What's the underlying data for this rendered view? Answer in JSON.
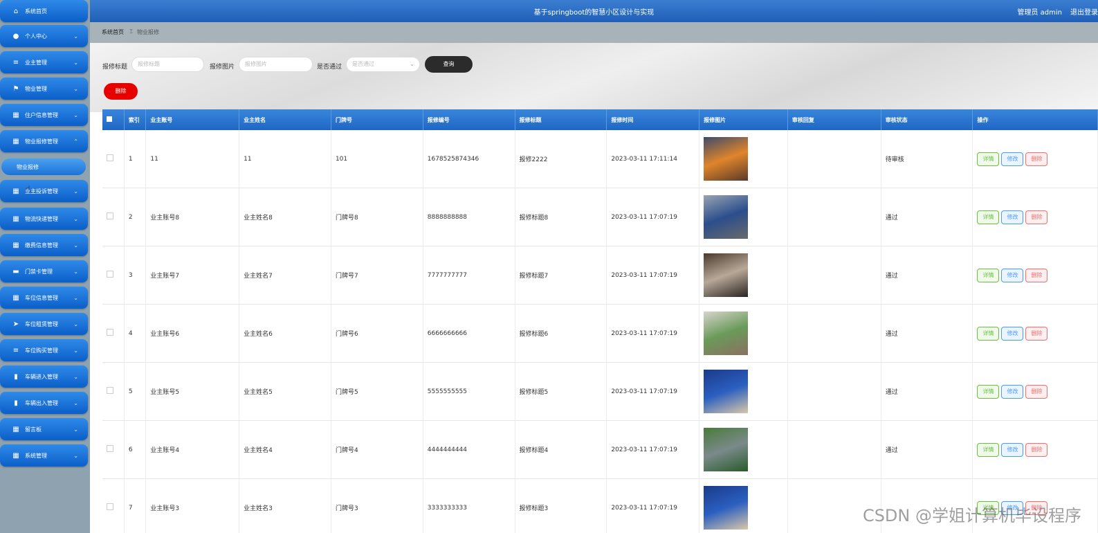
{
  "app_title": "基于springboot的智慧小区设计与实现",
  "user": {
    "label": "管理员 admin",
    "logout": "退出登录"
  },
  "breadcrumb": {
    "home": "系统首页",
    "sep": "Ξ",
    "current": "物业报修"
  },
  "sidebar": {
    "items": [
      {
        "label": "系统首页",
        "icon": "home-icon",
        "glyph": "⌂",
        "chev": ""
      },
      {
        "label": "个人中心",
        "icon": "user-icon",
        "glyph": "●",
        "chev": "⌄"
      },
      {
        "label": "业主管理",
        "icon": "list-icon",
        "glyph": "≡",
        "chev": "⌄"
      },
      {
        "label": "物业管理",
        "icon": "flag-icon",
        "glyph": "⚑",
        "chev": "⌄"
      },
      {
        "label": "住户信息管理",
        "icon": "grid-icon",
        "glyph": "▦",
        "chev": "⌄"
      },
      {
        "label": "物业报修管理",
        "icon": "grid-icon",
        "glyph": "▦",
        "chev": "⌃"
      },
      {
        "label": "业主投诉管理",
        "icon": "grid-icon",
        "glyph": "▦",
        "chev": "⌄"
      },
      {
        "label": "物流快递管理",
        "icon": "grid-icon",
        "glyph": "▦",
        "chev": "⌄"
      },
      {
        "label": "缴费信息管理",
        "icon": "grid-icon",
        "glyph": "▦",
        "chev": "⌄"
      },
      {
        "label": "门禁卡管理",
        "icon": "card-icon",
        "glyph": "▬",
        "chev": "⌄"
      },
      {
        "label": "车位信息管理",
        "icon": "grid-icon",
        "glyph": "▦",
        "chev": "⌄"
      },
      {
        "label": "车位租赁管理",
        "icon": "send-icon",
        "glyph": "➤",
        "chev": "⌄"
      },
      {
        "label": "车位购买管理",
        "icon": "list-icon",
        "glyph": "≡",
        "chev": "⌄"
      },
      {
        "label": "车辆进入管理",
        "icon": "bar-chart-icon",
        "glyph": "▮",
        "chev": "⌄"
      },
      {
        "label": "车辆出入管理",
        "icon": "bar-chart-icon",
        "glyph": "▮",
        "chev": "⌄"
      },
      {
        "label": "留言板",
        "icon": "grid-icon",
        "glyph": "▦",
        "chev": "⌄"
      },
      {
        "label": "系统管理",
        "icon": "grid-icon",
        "glyph": "▦",
        "chev": "⌄"
      }
    ],
    "sub_active": "物业报修"
  },
  "search": {
    "title_label": "报修标题",
    "title_placeholder": "报修标题",
    "image_label": "报修图片",
    "image_placeholder": "报修图片",
    "pass_label": "是否通过",
    "pass_placeholder": "是否通过",
    "query_button": "查询",
    "delete_button": "删除"
  },
  "table": {
    "headers": [
      "",
      "索引",
      "业主账号",
      "业主姓名",
      "门牌号",
      "报修编号",
      "报修标题",
      "报修时间",
      "报修图片",
      "审核回复",
      "审核状态",
      "操作"
    ],
    "ops": {
      "detail": "详情",
      "edit": "修改",
      "delete": "删除"
    },
    "rows": [
      {
        "idx": "1",
        "account": "11",
        "name": "11",
        "door": "101",
        "no": "1678525874346",
        "title": "报修2222",
        "time": "2023-03-11 17:11:14",
        "reply": "",
        "status": "待审核",
        "img": [
          "#3d4a6a",
          "#e0852a",
          "#5a3a2a"
        ]
      },
      {
        "idx": "2",
        "account": "业主账号8",
        "name": "业主姓名8",
        "door": "门牌号8",
        "no": "8888888888",
        "title": "报修标题8",
        "time": "2023-03-11 17:07:19",
        "reply": "",
        "status": "通过",
        "img": [
          "#9aa4b0",
          "#2b4e8c",
          "#6a6a6a"
        ]
      },
      {
        "idx": "3",
        "account": "业主账号7",
        "name": "业主姓名7",
        "door": "门牌号7",
        "no": "7777777777",
        "title": "报修标题7",
        "time": "2023-03-11 17:07:19",
        "reply": "",
        "status": "通过",
        "img": [
          "#4a3a2e",
          "#b8a898",
          "#2a2420"
        ]
      },
      {
        "idx": "4",
        "account": "业主账号6",
        "name": "业主姓名6",
        "door": "门牌号6",
        "no": "6666666666",
        "title": "报修标题6",
        "time": "2023-03-11 17:07:19",
        "reply": "",
        "status": "通过",
        "img": [
          "#d8d4cc",
          "#6a9a5a",
          "#8a7060"
        ]
      },
      {
        "idx": "5",
        "account": "业主账号5",
        "name": "业主姓名5",
        "door": "门牌号5",
        "no": "5555555555",
        "title": "报修标题5",
        "time": "2023-03-11 17:07:19",
        "reply": "",
        "status": "通过",
        "img": [
          "#1a3a8a",
          "#2b5fc0",
          "#d8c8a8"
        ]
      },
      {
        "idx": "6",
        "account": "业主账号4",
        "name": "业主姓名4",
        "door": "门牌号4",
        "no": "4444444444",
        "title": "报修标题4",
        "time": "2023-03-11 17:07:19",
        "reply": "",
        "status": "通过",
        "img": [
          "#4a7a3a",
          "#7a8a8a",
          "#2a5a2a"
        ]
      },
      {
        "idx": "7",
        "account": "业主账号3",
        "name": "业主姓名3",
        "door": "门牌号3",
        "no": "3333333333",
        "title": "报修标题3",
        "time": "2023-03-11 17:07:19",
        "reply": "",
        "status": "",
        "img": [
          "#1a3a8a",
          "#2b5fc0",
          "#d8c8a8"
        ]
      }
    ]
  },
  "watermark": "CSDN @学姐计算机毕设程序"
}
